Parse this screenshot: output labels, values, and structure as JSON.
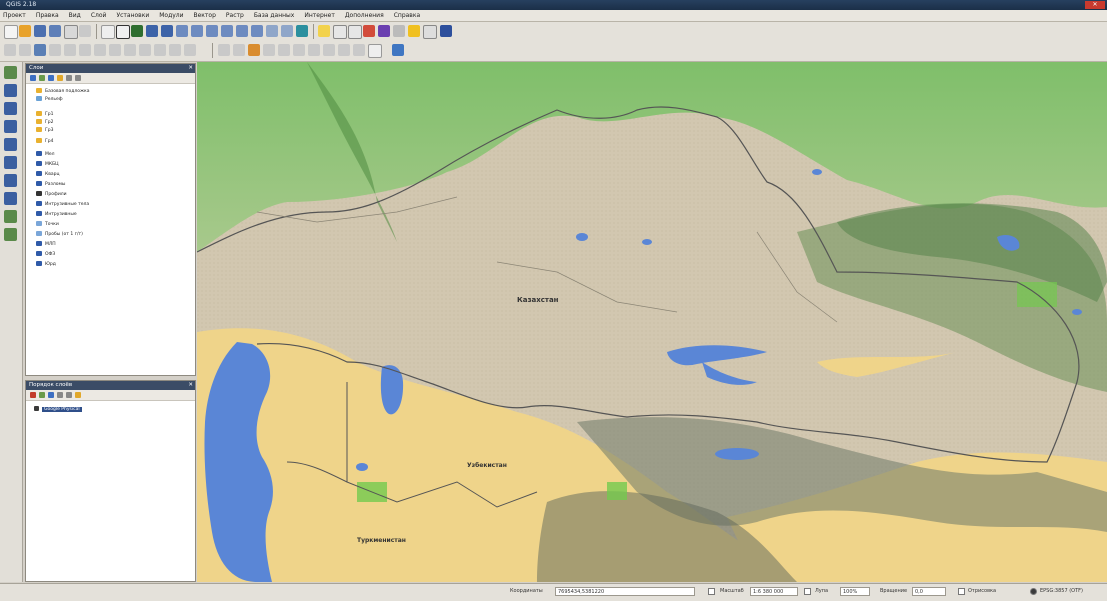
{
  "window": {
    "title": "QGIS 2.18"
  },
  "menu": [
    "Проект",
    "Правка",
    "Вид",
    "Слой",
    "Установки",
    "Модули",
    "Вектор",
    "Растр",
    "База данных",
    "Интернет",
    "Дополнения",
    "Справка"
  ],
  "layers_panel": {
    "title": "Слои",
    "items": [
      {
        "label": "Базовая подложка",
        "icon": "folder-icon",
        "color": "#e9b12f"
      },
      {
        "label": "Рельеф",
        "icon": "raster-icon",
        "color": "#6aa2d6"
      },
      {
        "label": "Гр1",
        "icon": "folder-icon",
        "color": "#e9b12f"
      },
      {
        "label": "Гр2",
        "icon": "folder-icon",
        "color": "#e9b12f"
      },
      {
        "label": "Гр3",
        "icon": "folder-icon",
        "color": "#e9b12f"
      },
      {
        "label": "Гр4",
        "icon": "folder-icon",
        "color": "#e9b12f"
      },
      {
        "label": "Мел",
        "icon": "polygon-icon",
        "color": "#2f5aa8"
      },
      {
        "label": "МКБЦ",
        "icon": "polygon-icon",
        "color": "#2f5aa8"
      },
      {
        "label": "Кварц",
        "icon": "polygon-icon",
        "color": "#2f5aa8"
      },
      {
        "label": "Разломы",
        "icon": "polygon-icon",
        "color": "#2f5aa8"
      },
      {
        "label": "Профили",
        "icon": "line-icon",
        "color": "#333333"
      },
      {
        "label": "Интрузивные тела",
        "icon": "polygon-icon",
        "color": "#2f5aa8"
      },
      {
        "label": "Интрузивные",
        "icon": "polygon-icon",
        "color": "#2f5aa8"
      },
      {
        "label": "Точки",
        "icon": "point-icon",
        "color": "#7aa6d8"
      },
      {
        "label": "Пробы (от 1 г/т)",
        "icon": "point-icon",
        "color": "#7aa6d8"
      },
      {
        "label": "МЛП",
        "icon": "polygon-icon",
        "color": "#2f5aa8"
      },
      {
        "label": "ОФЗ",
        "icon": "polygon-icon",
        "color": "#2f5aa8"
      },
      {
        "label": "Юрд",
        "icon": "polygon-icon",
        "color": "#2f5aa8"
      }
    ]
  },
  "order_panel": {
    "title": "Порядок слоёв",
    "items": [
      {
        "label": "Google Physical"
      }
    ]
  },
  "map": {
    "labels": {
      "kazakhstan": "Казахстан",
      "uzbekistan": "Узбекистан",
      "turkmenistan": "Туркменистан"
    }
  },
  "status": {
    "coord_label": "Координаты",
    "coord_value": "7695434,5381220",
    "scale_label": "Масштаб",
    "scale_value": "1:6 380 000",
    "magnifier_label": "Лупа",
    "magnifier_value": "100%",
    "rotation_label": "Вращение",
    "rotation_value": "0,0",
    "render_label": "Отрисовка",
    "crs_value": "EPSG:3857 (OTF)"
  }
}
